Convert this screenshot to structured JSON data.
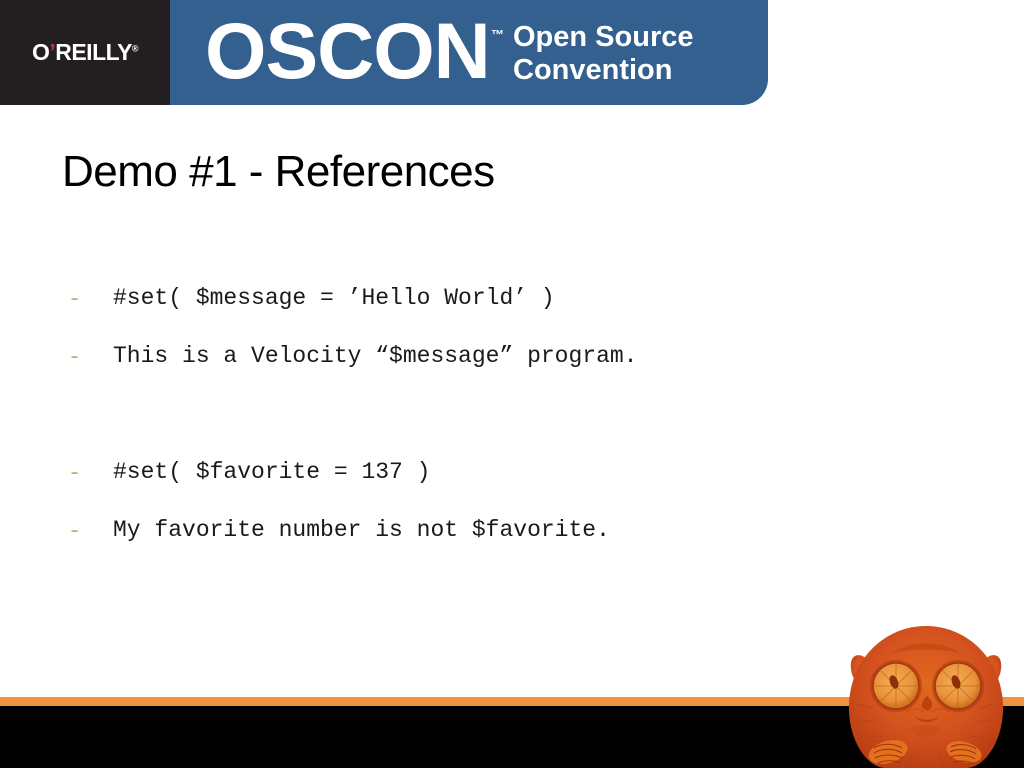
{
  "banner": {
    "publisher": {
      "name": "O'REILLY",
      "prefix": "O",
      "apostrophe": "’",
      "suffix": "REILLY",
      "registered_mark": "®"
    },
    "event_wordmark": "OSCON",
    "trademark": "™",
    "event_subtitle_line1": "Open Source",
    "event_subtitle_line2": "Convention",
    "colors": {
      "blue": "#33608e",
      "dark": "#231f20",
      "apostrophe_red": "#b7393f"
    }
  },
  "slide": {
    "title": "Demo #1 - References",
    "bullets": [
      {
        "marker": "-",
        "text": "#set( $message = ’Hello World’ )"
      },
      {
        "marker": "-",
        "text": "This is a Velocity “$message” program."
      },
      {
        "marker": "",
        "text": ""
      },
      {
        "marker": "-",
        "text": "#set( $favorite = 137 )"
      },
      {
        "marker": "-",
        "text": "My favorite number is not $favorite."
      }
    ]
  },
  "footer": {
    "stripe_color": "#f2913e",
    "bar_color": "#000000",
    "animal": "tarsier-illustration",
    "animal_color": "#d4521f"
  }
}
